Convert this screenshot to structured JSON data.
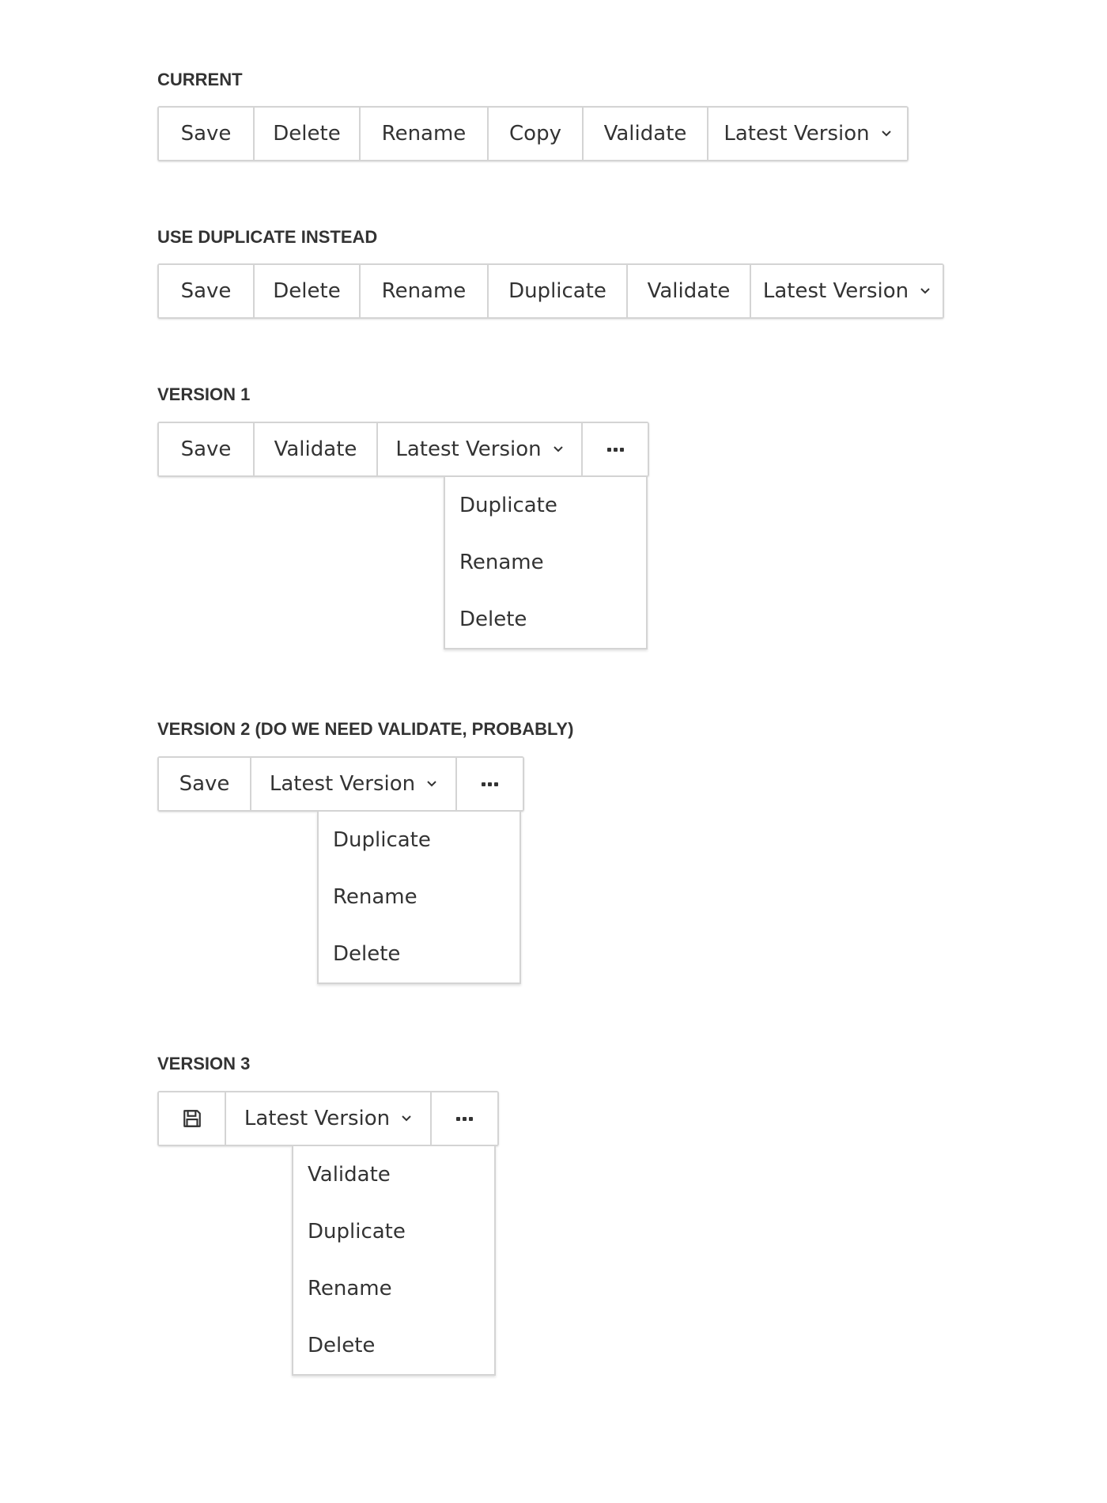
{
  "sections": [
    {
      "title": "CURRENT",
      "buttons": [
        "Save",
        "Delete",
        "Rename",
        "Copy",
        "Validate",
        "Latest Version"
      ]
    },
    {
      "title": "USE DUPLICATE INSTEAD",
      "buttons": [
        "Save",
        "Delete",
        "Rename",
        "Duplicate",
        "Validate",
        "Latest Version"
      ]
    },
    {
      "title": "VERSION 1",
      "buttons": [
        "Save",
        "Validate",
        "Latest Version"
      ],
      "menu_items": [
        "Duplicate",
        "Rename",
        "Delete"
      ]
    },
    {
      "title": "VERSION 2 (DO WE NEED VALIDATE, PROBABLY)",
      "buttons": [
        "Save",
        "Latest Version"
      ],
      "menu_items": [
        "Duplicate",
        "Rename",
        "Delete"
      ]
    },
    {
      "title": "VERSION 3",
      "buttons": [
        "Latest Version"
      ],
      "menu_items": [
        "Validate",
        "Duplicate",
        "Rename",
        "Delete"
      ]
    }
  ],
  "icons": {
    "save": "floppy-disk-icon",
    "more": "more-horizontal-icon",
    "dropdown": "chevron-down-icon"
  },
  "colors": {
    "text": "#333333",
    "border": "#d4d4d4",
    "background": "#ffffff"
  }
}
